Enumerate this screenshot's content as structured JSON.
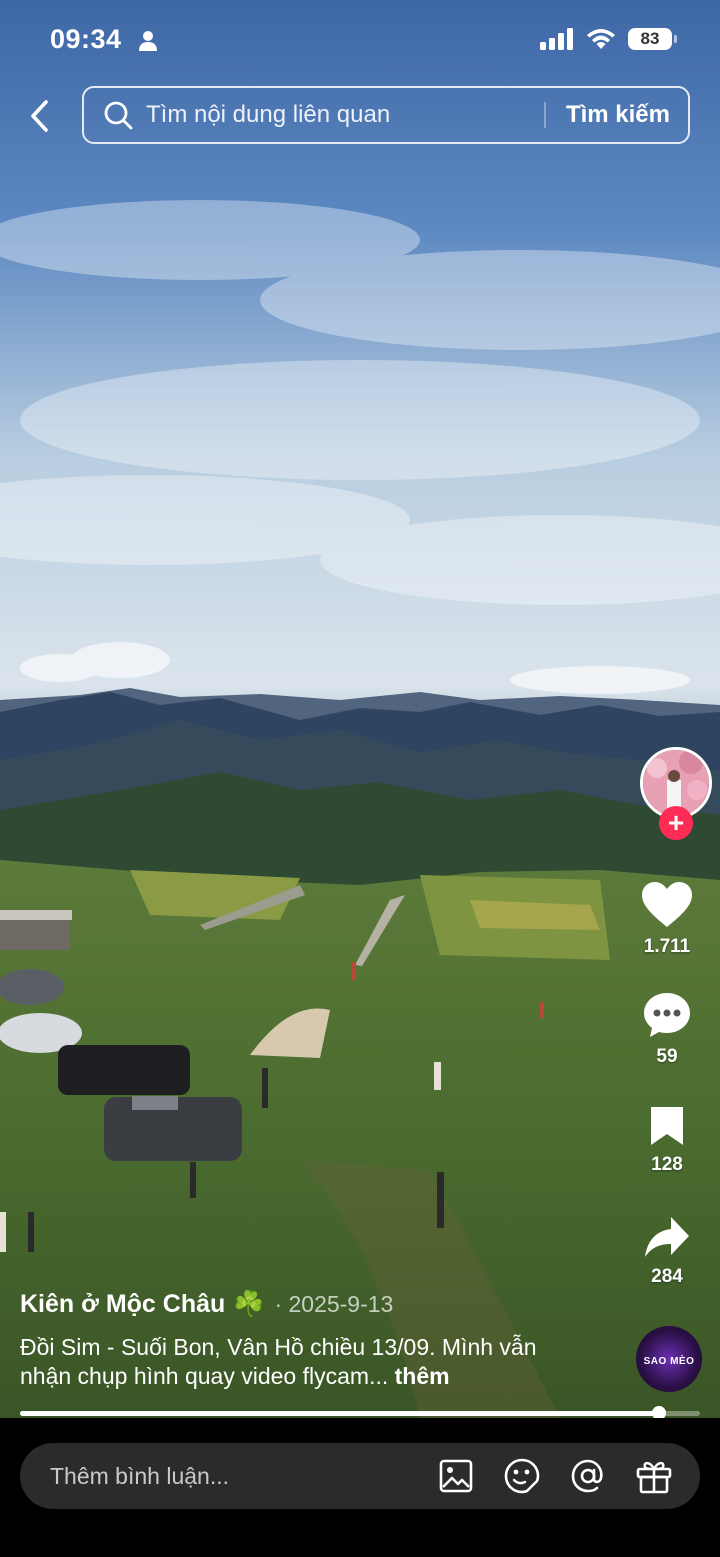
{
  "status_bar": {
    "time": "09:34",
    "battery": "83"
  },
  "search": {
    "placeholder": "Tìm nội dung liên quan",
    "submit_label": "Tìm kiếm"
  },
  "actions": {
    "likes": "1.711",
    "comments": "59",
    "saves": "128",
    "shares": "284"
  },
  "caption": {
    "author": "Kiên ở Mộc Châu",
    "author_emoji": "☘️",
    "date": "· 2025-9-13",
    "description": "Đồi Sim - Suối Bon, Vân Hồ chiều 13/09. Mình vẫn nhận chụp hình quay video flycam...",
    "more_label": "thêm"
  },
  "music": {
    "disc_label": "SAO MÈO"
  },
  "playback": {
    "progress": 0.94
  },
  "comment_bar": {
    "placeholder": "Thêm bình luận..."
  },
  "colors": {
    "accent": "#fe2c55"
  }
}
